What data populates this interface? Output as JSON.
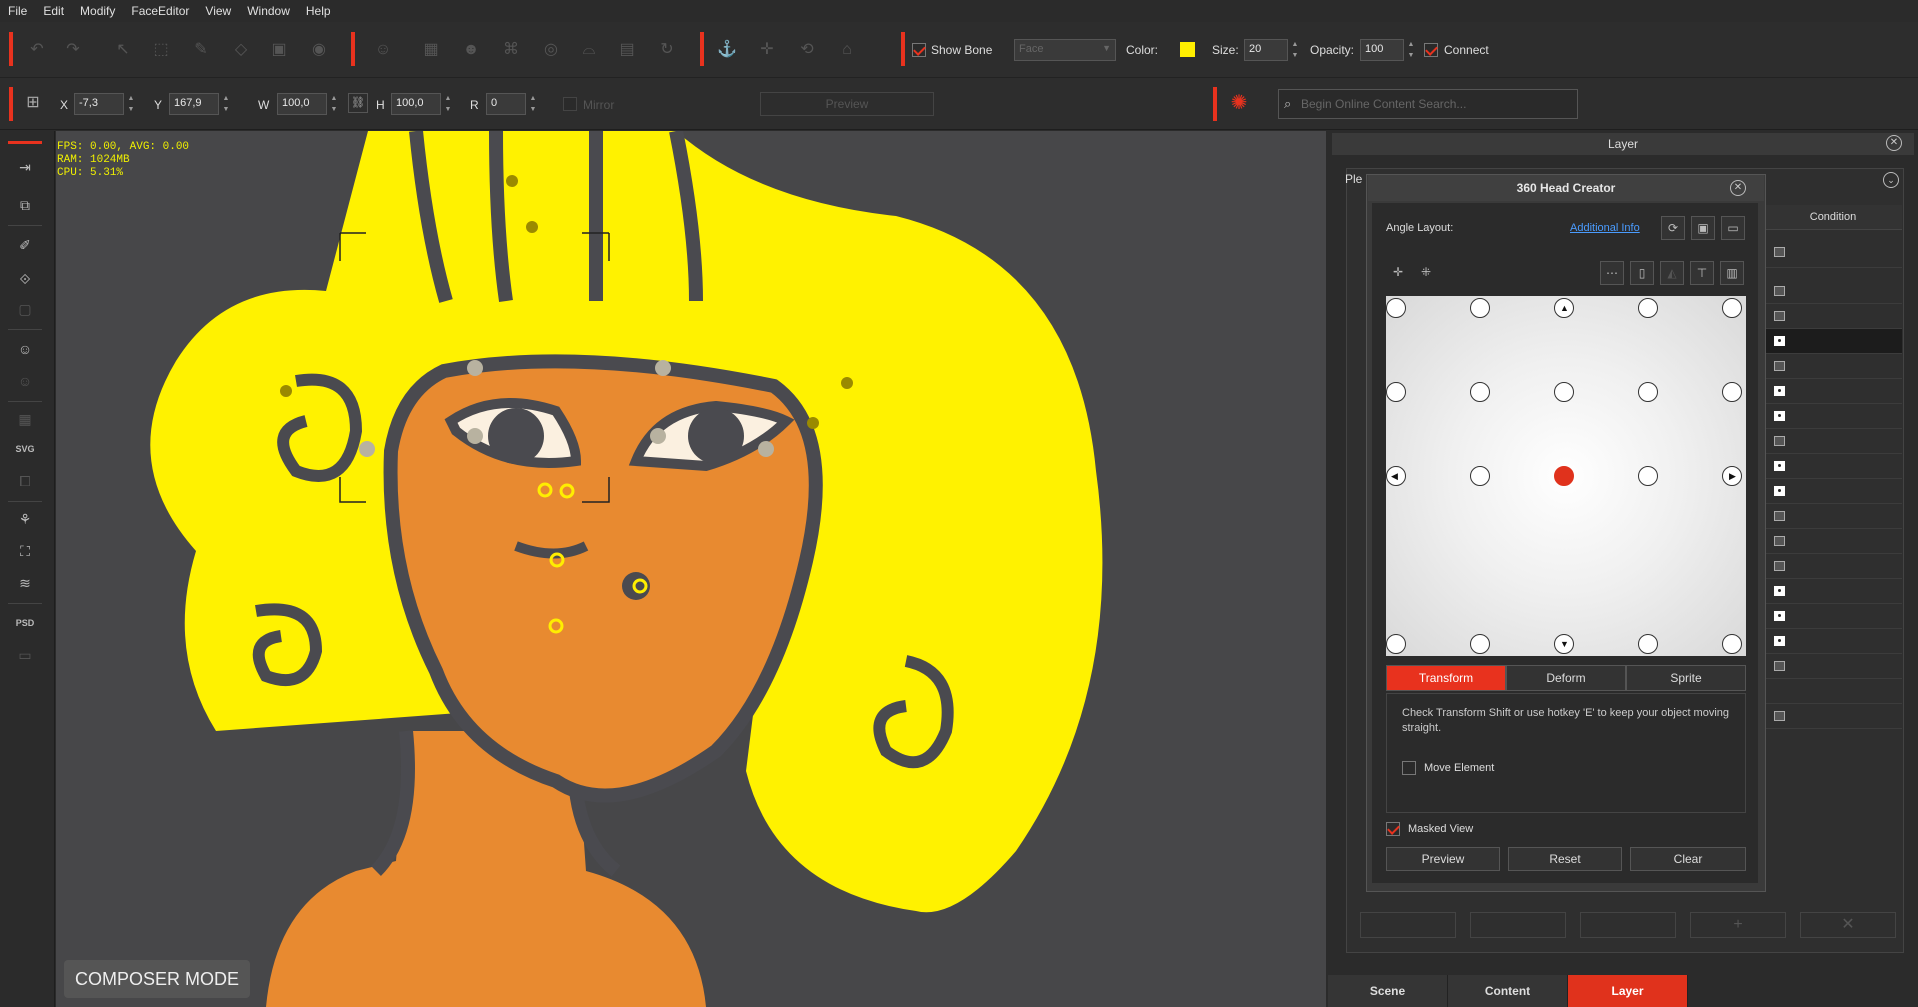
{
  "menu": [
    "File",
    "Edit",
    "Modify",
    "FaceEditor",
    "View",
    "Window",
    "Help"
  ],
  "toolbar": {
    "show_bone_label": "Show Bone",
    "face_dropdown": "Face",
    "color_label": "Color:",
    "color_value": "#ffee00",
    "size_label": "Size:",
    "size_value": "20",
    "opacity_label": "Opacity:",
    "opacity_value": "100",
    "connect_label": "Connect"
  },
  "transform": {
    "x_label": "X",
    "x_value": "-7,3",
    "y_label": "Y",
    "y_value": "167,9",
    "w_label": "W",
    "w_value": "100,0",
    "h_label": "H",
    "h_value": "100,0",
    "r_label": "R",
    "r_value": "0",
    "mirror_label": "Mirror",
    "preview_label": "Preview"
  },
  "search": {
    "placeholder": "Begin Online Content Search..."
  },
  "stats": {
    "fps": "FPS: 0.00, AVG: 0.00",
    "ram": "RAM: 1024MB",
    "cpu": "CPU: 5.31%"
  },
  "composer_label": "COMPOSER MODE",
  "layer_panel": {
    "title": "Layer",
    "ple_label": "Ple",
    "condition_header": "Condition"
  },
  "head_creator": {
    "title": "360 Head Creator",
    "angle_layout_label": "Angle Layout:",
    "additional_info": "Additional Info",
    "tabs": [
      "Transform",
      "Deform",
      "Sprite"
    ],
    "active_tab": "Transform",
    "hint": "Check Transform Shift or use hotkey 'E' to keep your object moving straight.",
    "move_element_label": "Move Element",
    "masked_view_label": "Masked View",
    "preview_btn": "Preview",
    "reset_btn": "Reset",
    "clear_btn": "Clear"
  },
  "bottom_tabs": [
    "Scene",
    "Content",
    "Layer"
  ],
  "active_bottom_tab": "Layer"
}
